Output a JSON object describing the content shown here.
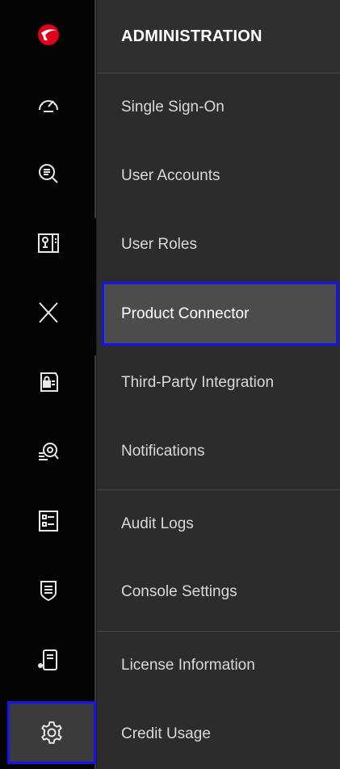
{
  "app": {
    "brand_color": "#e0001b",
    "accent_color": "#1414f0"
  },
  "rail": {
    "items": [
      {
        "name": "trend-logo-icon",
        "active": false
      },
      {
        "name": "dashboard-gauge-icon",
        "active": false
      },
      {
        "name": "search-list-icon",
        "active": false
      },
      {
        "name": "device-monitor-icon",
        "active": false
      },
      {
        "name": "xdr-cross-icon",
        "active": false
      },
      {
        "name": "lock-policy-icon",
        "active": false
      },
      {
        "name": "threat-search-icon",
        "active": false
      },
      {
        "name": "checklist-icon",
        "active": false
      },
      {
        "name": "shield-list-icon",
        "active": false
      },
      {
        "name": "mobile-device-icon",
        "active": false
      },
      {
        "name": "network-nodes-icon",
        "active": false
      },
      {
        "name": "settings-gear-icon",
        "active": true
      }
    ]
  },
  "panel": {
    "title": "ADMINISTRATION",
    "items": [
      {
        "label": "Single Sign-On"
      },
      {
        "label": "User Accounts"
      },
      {
        "label": "User Roles"
      },
      {
        "label": "Product Connector",
        "active": true
      },
      {
        "label": "Third-Party Integration"
      },
      {
        "label": "Notifications"
      },
      {
        "label": "Audit Logs"
      },
      {
        "label": "Console Settings"
      },
      {
        "label": "License Information"
      },
      {
        "label": "Credit Usage"
      }
    ]
  }
}
